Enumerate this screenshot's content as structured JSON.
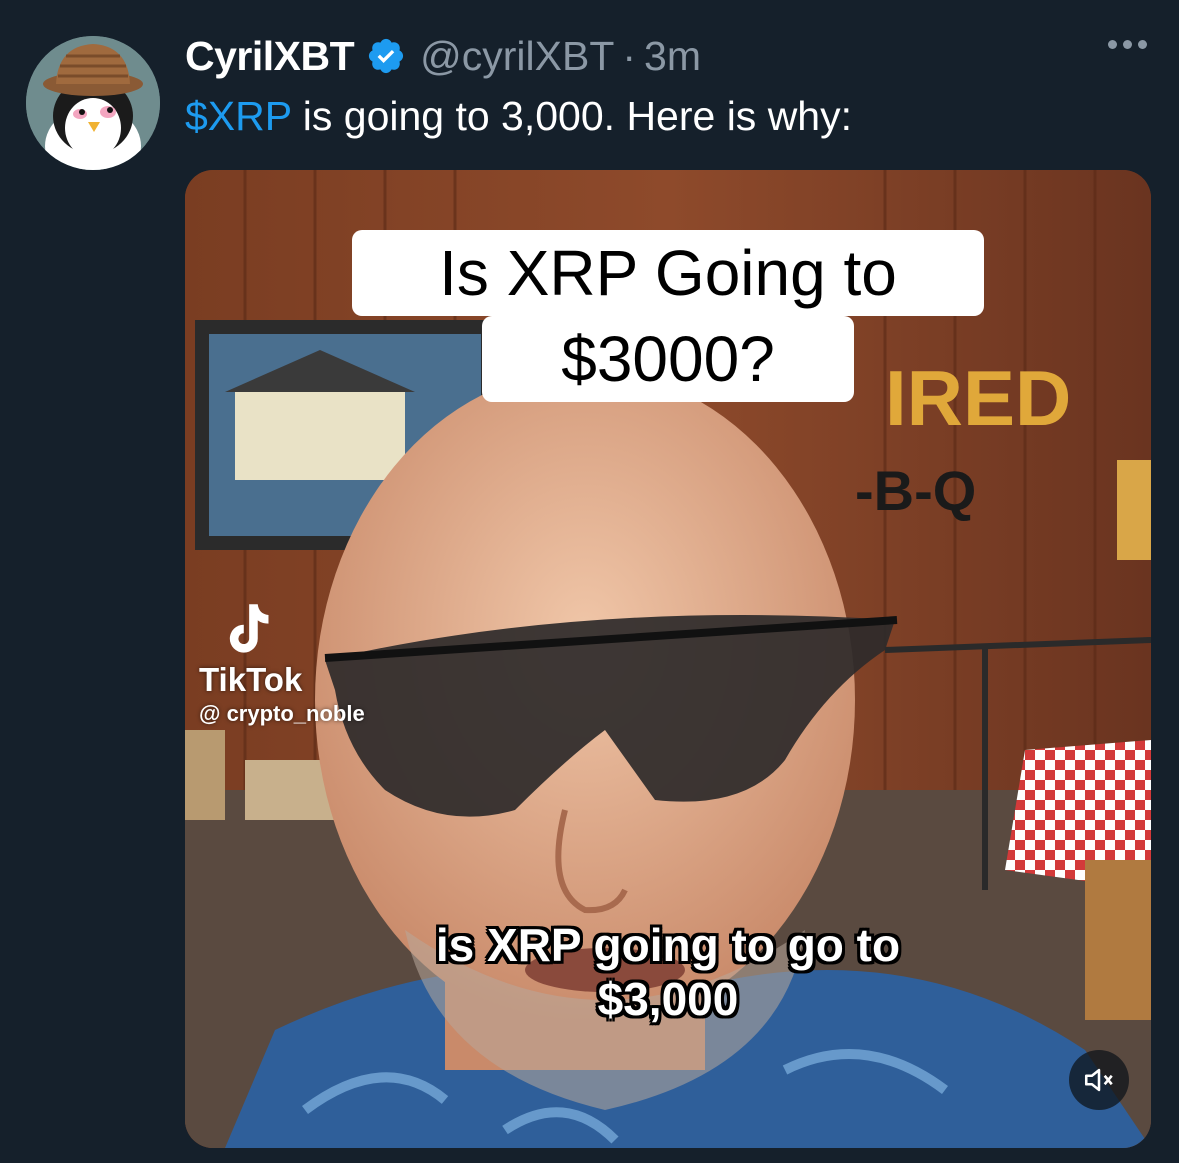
{
  "tweet": {
    "display_name": "CyrilXBT",
    "verified_icon": "verified-badge-icon",
    "handle": "@cyrilXBT",
    "separator": "·",
    "time": "3m",
    "text_cashtag": "$XRP",
    "text_rest": " is going to 3,000. Here is why:"
  },
  "media": {
    "caption_top_line1": "Is XRP Going to",
    "caption_top_line2": "$3000?",
    "caption_bottom_line1": "is XRP going to go to",
    "caption_bottom_line2": "$3,000",
    "watermark_brand": "TikTok",
    "watermark_user": "@ crypto_noble",
    "sign_text_1": "IRED",
    "sign_text_2": "-B-Q",
    "mute_icon": "volume-muted-icon"
  },
  "colors": {
    "background": "#15202b",
    "accent": "#1d9bf0",
    "muted_text": "#8b98a5"
  }
}
